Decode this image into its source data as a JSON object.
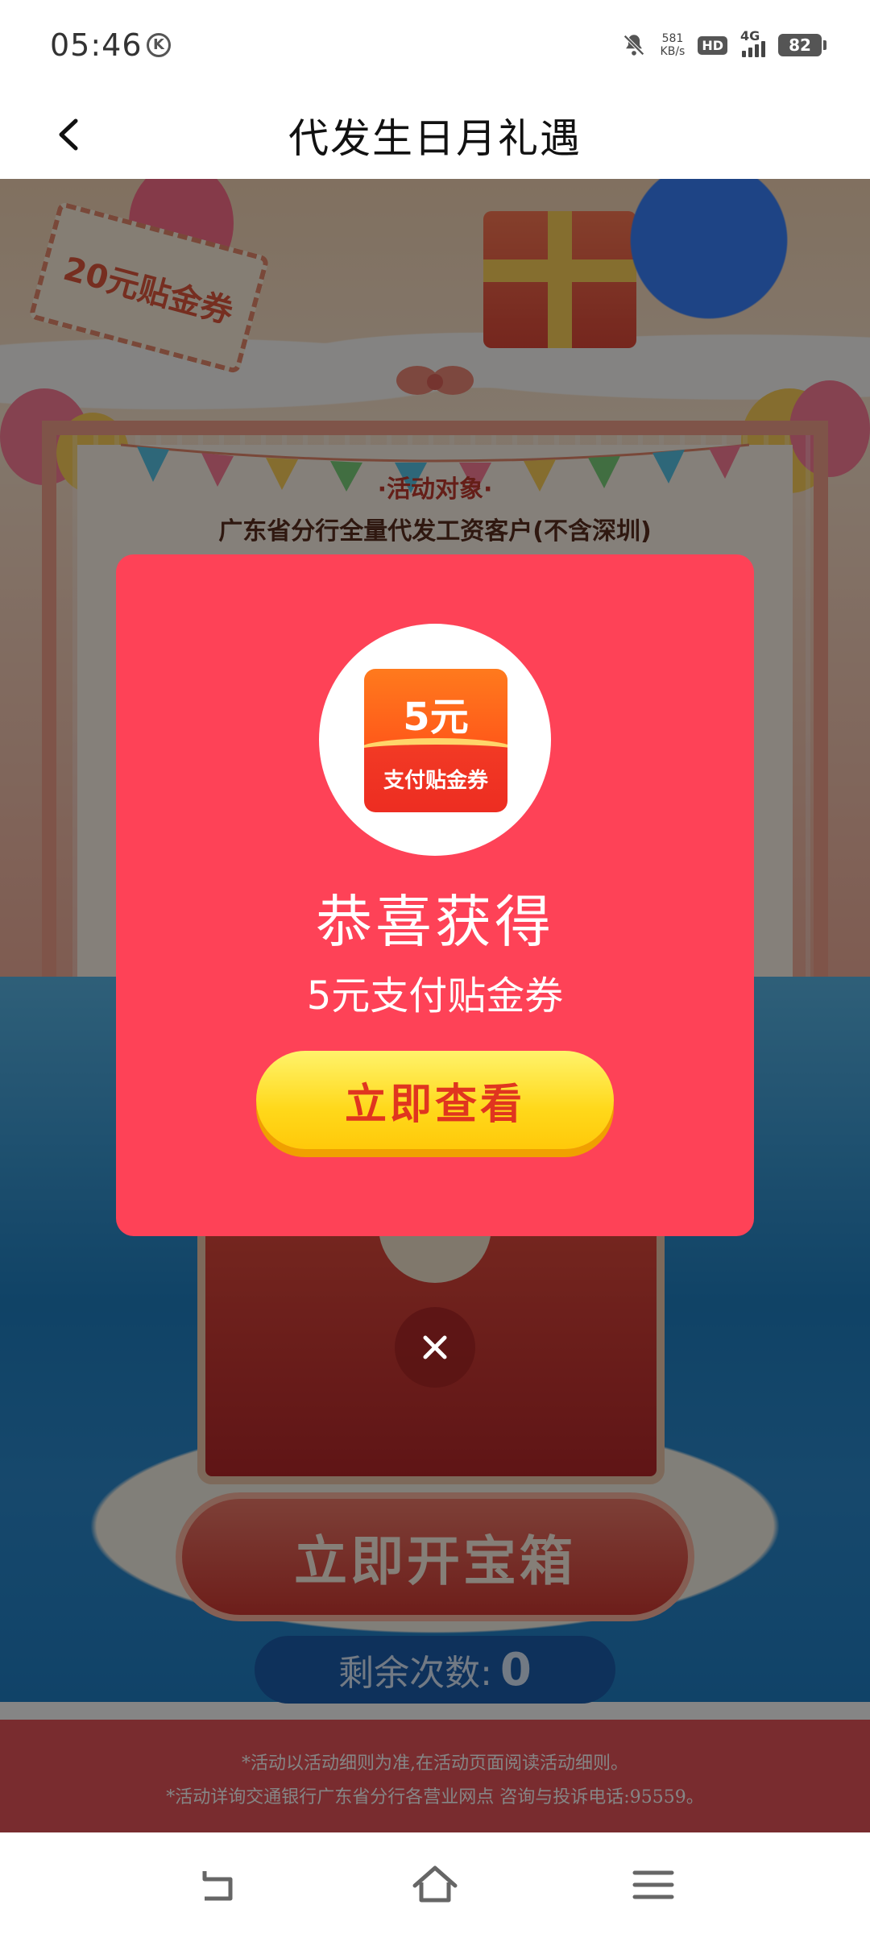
{
  "status_bar": {
    "time": "05:46",
    "net_speed_value": "581",
    "net_speed_unit": "KB/s",
    "hd": "HD",
    "network": "4G",
    "battery": "82"
  },
  "nav": {
    "title": "代发生日月礼遇"
  },
  "background": {
    "coupon_text": "20元贴金券",
    "target_heading": "·活动对象·",
    "target_text": "广东省分行全量代发工资客户(不含深圳)",
    "open_chest_label": "立即开宝箱",
    "remaining_label": "剩余次数:",
    "remaining_count": "0",
    "footer_note_1": "*活动以活动细则为准,在活动页面阅读活动细则。",
    "footer_note_2": "*活动详询交通银行广东省分行各营业网点 咨询与投诉电话:95559。"
  },
  "modal": {
    "coupon_amount": "5元",
    "coupon_label": "支付贴金券",
    "congrats": "恭喜获得",
    "prize_name": "5元支付贴金券",
    "view_button": "立即查看"
  },
  "icons": {
    "back": "chevron-left-icon",
    "close": "close-icon",
    "nav_back": "back-arrow-icon",
    "nav_home": "home-icon",
    "nav_menu": "menu-icon"
  },
  "colors": {
    "modal_bg": "#fe4257",
    "button_yellow": "#ffd81a",
    "button_text": "#e0351f"
  }
}
